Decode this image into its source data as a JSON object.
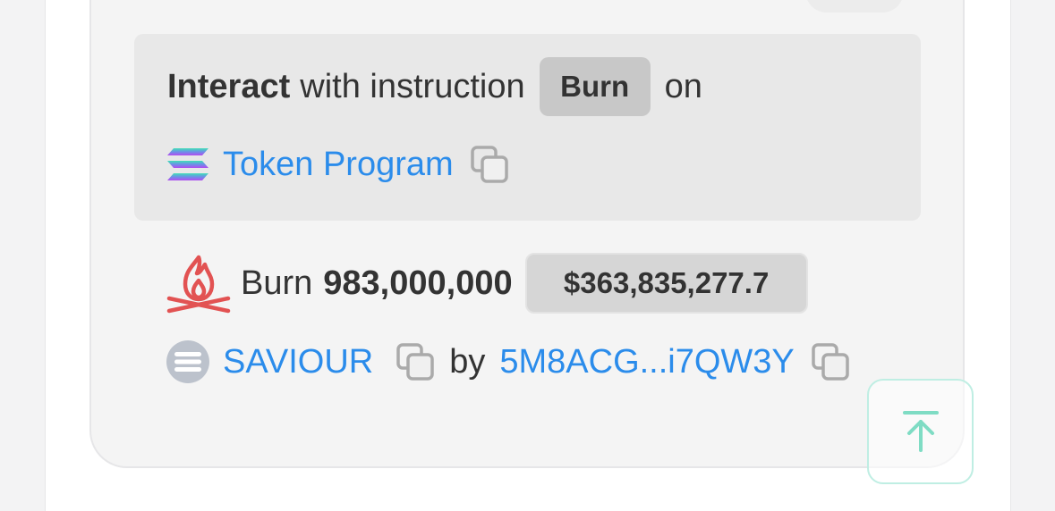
{
  "instruction": {
    "prefix_bold": "Interact",
    "prefix_text": "with instruction",
    "instruction_name": "Burn",
    "suffix_text": "on",
    "program_name": "Token Program"
  },
  "burn_event": {
    "verb": "Burn",
    "amount": "983,000,000",
    "usd_value": "$363,835,277.7",
    "token_name": "SAVIOUR",
    "by_label": "by",
    "address": "5M8ACG...i7QW3Y"
  },
  "icons": {
    "program": "solana-logo-icon",
    "burn": "fire-icon",
    "token": "token-avatar-icon",
    "copy": "copy-icon",
    "scroll_top": "arrow-up-to-line-icon"
  },
  "colors": {
    "link": "#2b8ceb",
    "fire": "#e25252",
    "scroll_top_border": "#bfeee3",
    "scroll_top_arrow": "#7fdcc4"
  }
}
